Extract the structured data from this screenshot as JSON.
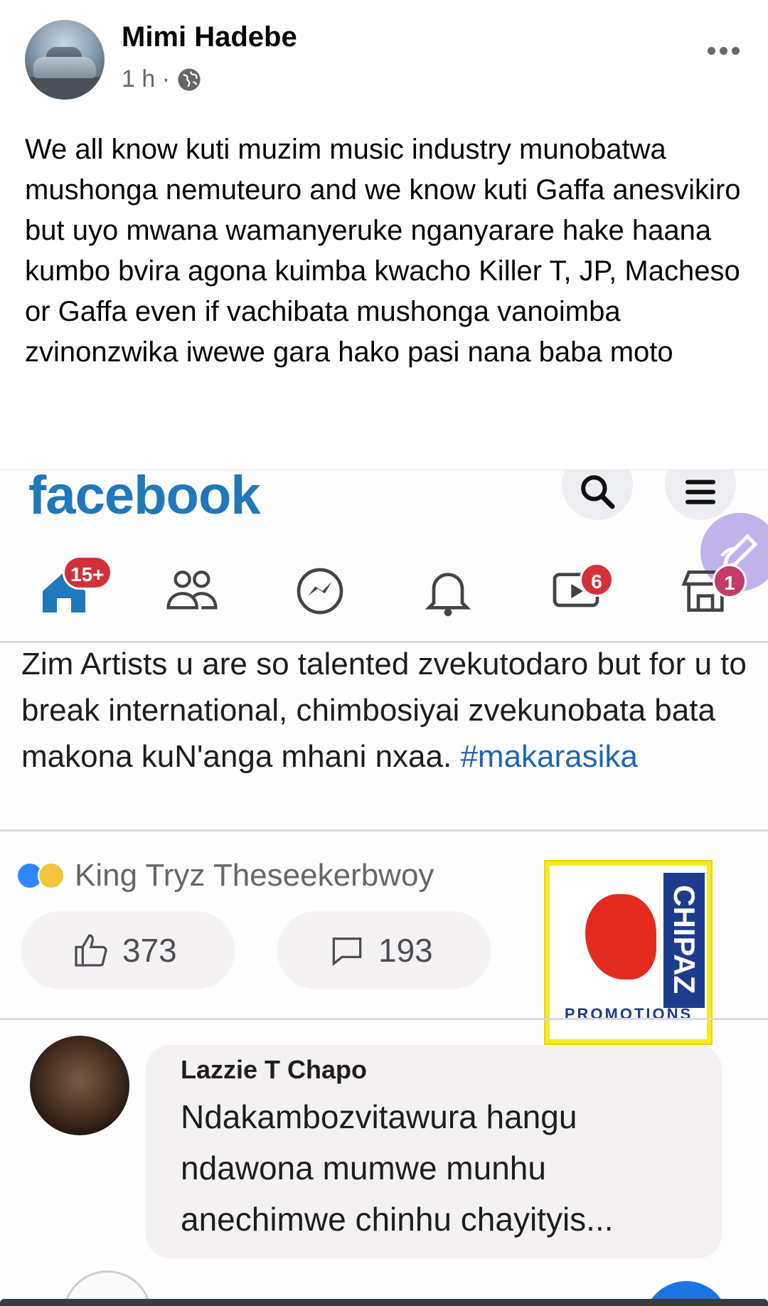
{
  "post": {
    "author": "Mimi Hadebe",
    "time": "1 h ·",
    "text": "We all know kuti muzim music industry munobatwa mushonga nemuteuro and we know kuti Gaffa anesvikiro but uyo mwana wamanyeruke nganyarare hake haana kumbo bvira agona kuimba kwacho Killer T, JP, Macheso or Gaffa even if vachibata mushonga vanoimba zvinonzwika iwewe gara hako pasi nana baba moto"
  },
  "screenshot": {
    "logo": "facebook",
    "nav_badges": {
      "home": "15+",
      "watch": "6",
      "marketplace": "1"
    },
    "post_text": "Zim Artists u are so talented zvekutodaro but for u to break international, chimbosiyai zvekunobata bata makona kuN'anga mhani nxaa.",
    "hashtag": "#makarasika",
    "reactors": "King Tryz Theseekerbwoy",
    "like_count": "373",
    "comment_count": "193",
    "sticker_brand": "CHIPAZ",
    "sticker_promo": "PROMOTIONS",
    "comment_author": "Lazzie T Chapo",
    "comment_text": "Ndakambozvitawura  hangu ndawona mumwe munhu anechimwe chinhu chayityis..."
  },
  "icons": {
    "globe": "globe-icon",
    "more": "more-options-icon",
    "search": "search-icon",
    "menu": "menu-icon",
    "edit": "edit-pen-icon",
    "home": "home-icon",
    "friends": "friends-icon",
    "messenger": "messenger-icon",
    "notifications": "bell-icon",
    "watch": "watch-icon",
    "marketplace": "marketplace-icon",
    "like": "like-icon",
    "comment": "comment-icon"
  },
  "colors": {
    "facebook_blue": "#1f78b9",
    "badge_red": "#d3303a",
    "hashtag": "#1f65b4",
    "secondary_text": "#65676b"
  }
}
